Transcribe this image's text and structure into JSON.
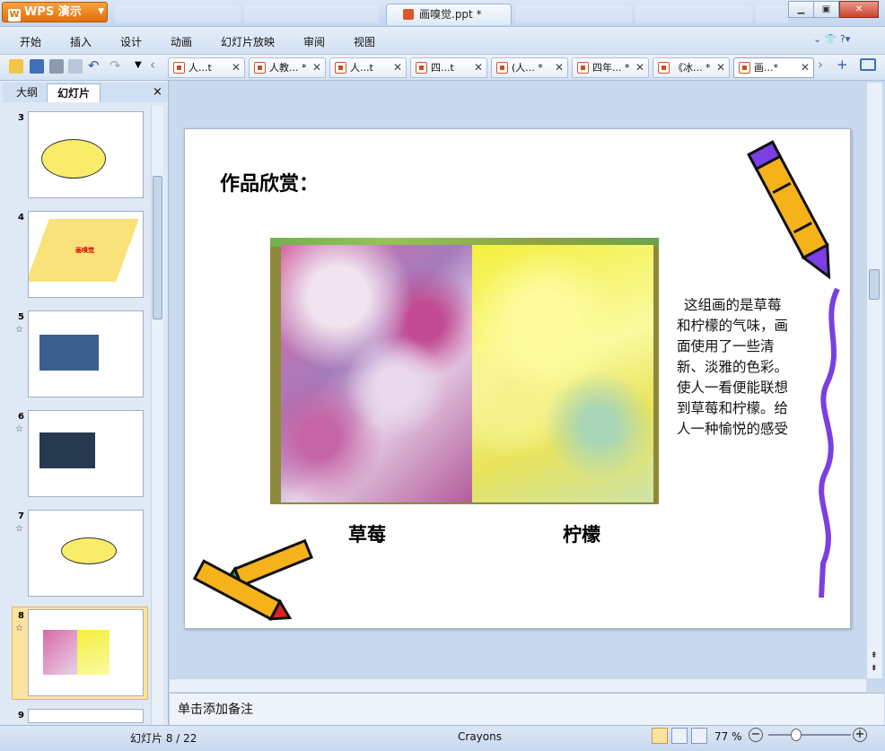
{
  "app": {
    "name": "WPS 演示",
    "window_title": "画嗅觉.ppt *"
  },
  "menu": [
    "开始",
    "插入",
    "设计",
    "动画",
    "幻灯片放映",
    "审阅",
    "视图"
  ],
  "doc_tabs": [
    "人...t",
    "人教... *",
    "人...t",
    "四...t",
    "(人... *",
    "四年... *",
    "《冰... *",
    "画...*"
  ],
  "panel": {
    "tab_outline": "大纲",
    "tab_slides": "幻灯片",
    "close": "×"
  },
  "thumbnails": [
    {
      "num": "3"
    },
    {
      "num": "4"
    },
    {
      "num": "5",
      "star": "☆"
    },
    {
      "num": "6",
      "star": "☆"
    },
    {
      "num": "7",
      "star": "☆"
    },
    {
      "num": "8",
      "star": "☆"
    },
    {
      "num": "9"
    }
  ],
  "thumbnail_texts": {
    "t4_label": "画嗅觉"
  },
  "slide": {
    "title": "作品欣赏：",
    "caption_left": "草莓",
    "caption_right": "柠檬",
    "body": "这组画的是草莓和柠檬的气味，画面使用了一些清新、淡雅的色彩。使人一看便能联想到草莓和柠檬。给人一种愉悦的感受"
  },
  "notes_placeholder": "单击添加备注",
  "status": {
    "slide_count": "幻灯片 8 / 22",
    "theme": "Crayons",
    "zoom": "77 %"
  },
  "colors": {
    "accent": "#e0700e",
    "selected_thumb": "#fbe3a2",
    "crayon_yellow": "#f5b21b",
    "squiggle": "#7b3fe4"
  }
}
